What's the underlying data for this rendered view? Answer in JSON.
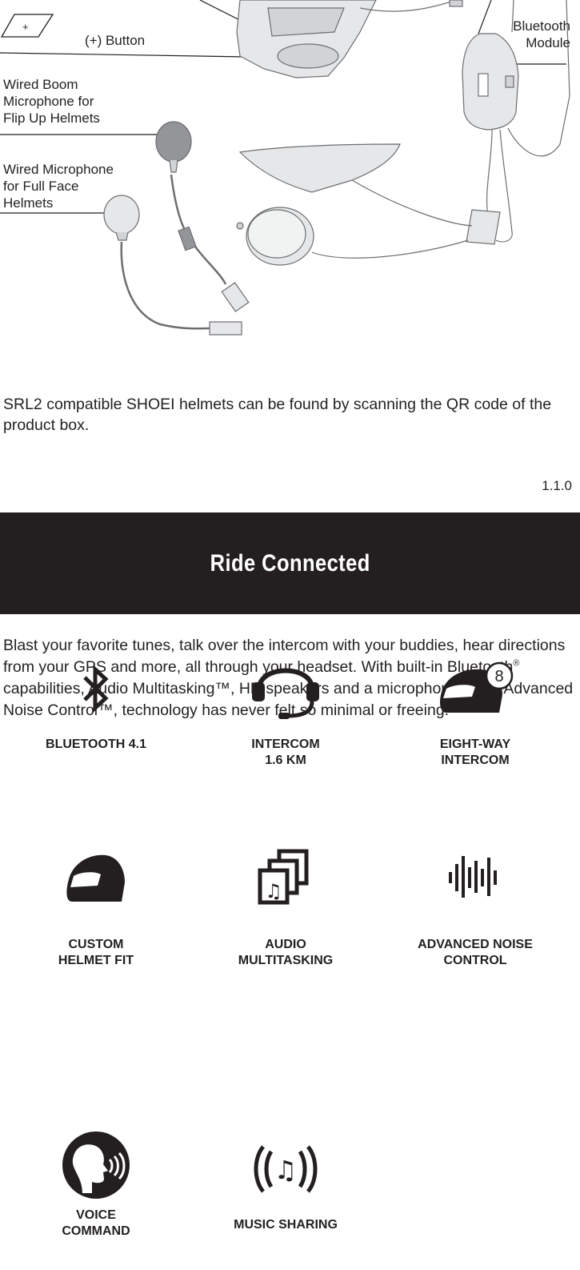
{
  "diagram": {
    "labels": {
      "plus_button": "(+) Button",
      "plus_symbol": "+",
      "bluetooth_module": "Bluetooth\nModule",
      "boom_mic": "Wired Boom\nMicrophone for\nFlip Up Helmets",
      "wired_mic": "Wired Microphone\nfor Full Face\nHelmets"
    }
  },
  "intro_text": "SRL2 compatible SHOEI helmets can be found by scanning the QR code of the product box.",
  "version": "1.1.0",
  "banner": {
    "title": "Ride Connected"
  },
  "blurb": {
    "part1": "Blast your favorite tunes, talk over the intercom with your buddies, hear directions from your GPS and more, all through your headset. With built-in Bluetooth",
    "reg": "®",
    "part2": " capabilities,  Audio Multitasking™, HD speakers and a microphone using Advanced Noise Control™, technology has never felt so minimal or freeing."
  },
  "features": [
    {
      "label": "BLUETOOTH 4.1",
      "icon": "bluetooth-icon"
    },
    {
      "label": "INTERCOM\n1.6 KM",
      "icon": "headset-icon"
    },
    {
      "label": "EIGHT-WAY\nINTERCOM",
      "icon": "helmet-eight-icon",
      "badge": "8"
    },
    {
      "label": "CUSTOM\nHELMET FIT",
      "icon": "helmet-icon"
    },
    {
      "label": "AUDIO\nMULTITASKING",
      "icon": "audio-multitasking-icon",
      "note_glyph": "♫"
    },
    {
      "label": "ADVANCED NOISE\nCONTROL",
      "icon": "sound-wave-icon"
    },
    {
      "label": "VOICE\nCOMMAND",
      "icon": "voice-command-icon"
    },
    {
      "label": "MUSIC SHARING",
      "icon": "music-sharing-icon",
      "note_glyph": "♫"
    }
  ],
  "colors": {
    "ink": "#231f20",
    "banner_bg": "#231f20",
    "banner_text": "#ffffff"
  }
}
